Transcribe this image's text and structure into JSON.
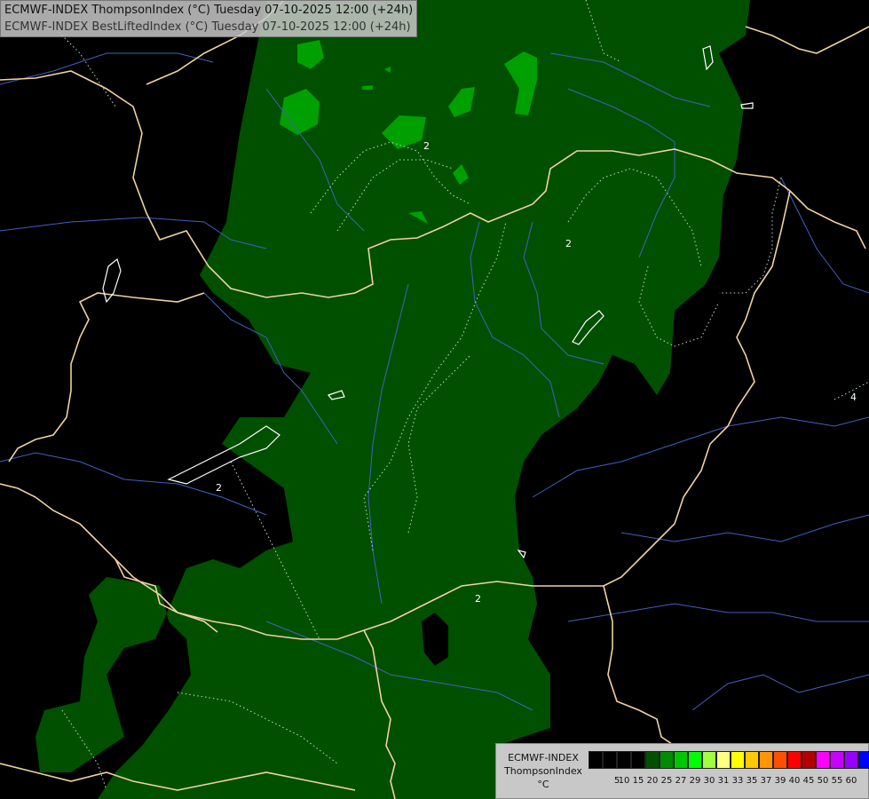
{
  "titles": {
    "line1": "ECMWF-INDEX ThompsonIndex (°C) Tuesday 07-10-2025 12:00 (+24h)",
    "line2": "ECMWF-INDEX BestLiftedIndex (°C) Tuesday 07-10-2025 12:00 (+24h)"
  },
  "legend": {
    "line1": "ECMWF-INDEX",
    "line2": "ThompsonIndex",
    "line3": "°C",
    "colors": [
      "#000000",
      "#000000",
      "#000000",
      "#000000",
      "#005000",
      "#008c00",
      "#00c800",
      "#00ff00",
      "#a0ff40",
      "#ffff80",
      "#ffff00",
      "#ffc800",
      "#ff9600",
      "#ff5000",
      "#ff0000",
      "#b40000",
      "#ff00ff",
      "#c800ff",
      "#9600ff",
      "#0000ff"
    ],
    "ticks": [
      "5",
      "10",
      "15",
      "20",
      "25",
      "27",
      "29",
      "30",
      "31",
      "33",
      "35",
      "37",
      "39",
      "40",
      "45",
      "50",
      "55",
      "60"
    ]
  },
  "contour_labels": [
    "2",
    "2",
    "2",
    "2",
    "4"
  ],
  "map_colors": {
    "background": "#000000",
    "field_low": "#005000",
    "field_high": "#00a000",
    "borders": "#f0d2a0",
    "rivers": "#4060c0",
    "lakes": "#ffffff"
  }
}
